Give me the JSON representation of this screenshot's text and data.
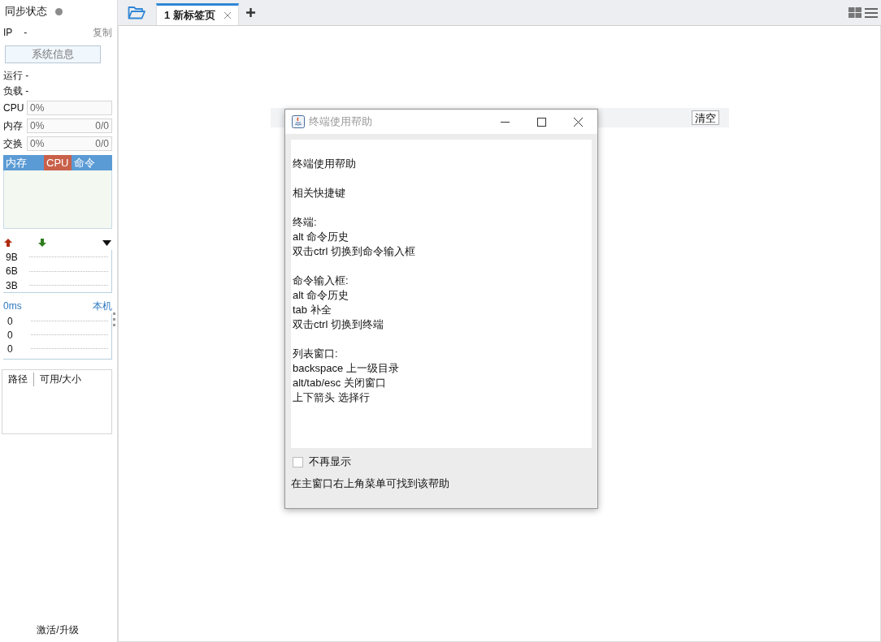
{
  "sidebar": {
    "sync_status": {
      "label": "同步状态"
    },
    "ip": {
      "label": "IP",
      "value": "-",
      "copy": "复制"
    },
    "system_info_button": "系统信息",
    "stats": [
      "运行 -",
      "负载 -"
    ],
    "meters": [
      {
        "label": "CPU",
        "reading": "0%"
      },
      {
        "label": "内存",
        "reading": "0%",
        "amount": "0/0"
      },
      {
        "label": "交换",
        "reading": "0%",
        "amount": "0/0"
      }
    ],
    "process_tabs": [
      {
        "label": "内存",
        "selected": false
      },
      {
        "label": "CPU",
        "selected": true
      },
      {
        "label": "命令",
        "selected": false
      }
    ],
    "network": {
      "axis_labels": [
        "9B",
        "6B",
        "3B"
      ]
    },
    "ping": {
      "latency": "0ms",
      "host": "本机",
      "values": [
        "0",
        "0",
        "0"
      ]
    },
    "disk_table": {
      "columns": [
        "路径",
        "可用/大小"
      ]
    },
    "footer_link": "激活/升级"
  },
  "tabs": [
    {
      "label": "1 新标签页",
      "selected": true
    }
  ],
  "command_bar": {
    "button": "清空"
  },
  "dialog": {
    "title": "终端使用帮助",
    "paragraphs": [
      [
        "终端使用帮助"
      ],
      [
        "相关快捷键"
      ],
      [
        "终端:",
        "alt 命令历史",
        "双击ctrl 切换到命令输入框"
      ],
      [
        "命令输入框:",
        "alt 命令历史",
        "tab 补全",
        "双击ctrl 切换到终端"
      ],
      [
        "列表窗口:",
        "backspace 上一级目录",
        "alt/tab/esc 关闭窗口",
        "上下箭头 选择行"
      ]
    ],
    "dont_show_again": {
      "label": "不再显示",
      "checked": false
    },
    "hint": "在主窗口右上角菜单可找到该帮助"
  }
}
